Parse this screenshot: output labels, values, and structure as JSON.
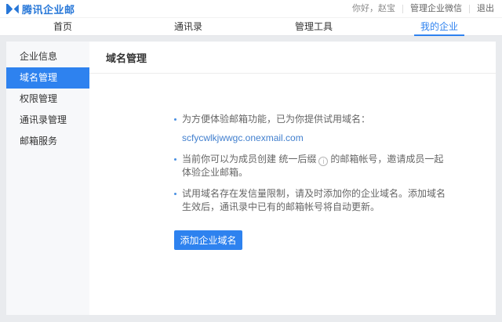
{
  "header": {
    "logo_text": "腾讯企业邮",
    "greeting": "你好，赵宝",
    "manage_wechat_label": "管理企业微信",
    "logout_label": "退出"
  },
  "nav": {
    "tabs": [
      {
        "label": "首页",
        "active": false
      },
      {
        "label": "通讯录",
        "active": false
      },
      {
        "label": "管理工具",
        "active": false
      },
      {
        "label": "我的企业",
        "active": true
      }
    ]
  },
  "sidebar": {
    "items": [
      {
        "label": "企业信息",
        "active": false
      },
      {
        "label": "域名管理",
        "active": true
      },
      {
        "label": "权限管理",
        "active": false
      },
      {
        "label": "通讯录管理",
        "active": false
      },
      {
        "label": "邮箱服务",
        "active": false
      }
    ]
  },
  "main": {
    "title": "域名管理",
    "bullet1_text": "为方便体验邮箱功能，已为你提供试用域名：",
    "bullet1_link": "scfycwlkjwwgc.onexmail.com",
    "bullet2_pre": "当前你可以为成员创建 统一后缀",
    "bullet2_post": "的邮箱帐号，邀请成员一起体验企业邮箱。",
    "bullet3_text": "试用域名存在发信量限制，请及时添加你的企业域名。添加域名生效后，通讯录中已有的邮箱帐号将自动更新。",
    "info_icon_glyph": "i",
    "add_domain_button": "添加企业域名"
  },
  "colors": {
    "accent_blue": "#2e82ef",
    "logo_blue": "#2777d8",
    "link_blue": "#417fce",
    "page_bg": "#e9ebee",
    "sidebar_bg": "#f7f8fa"
  }
}
